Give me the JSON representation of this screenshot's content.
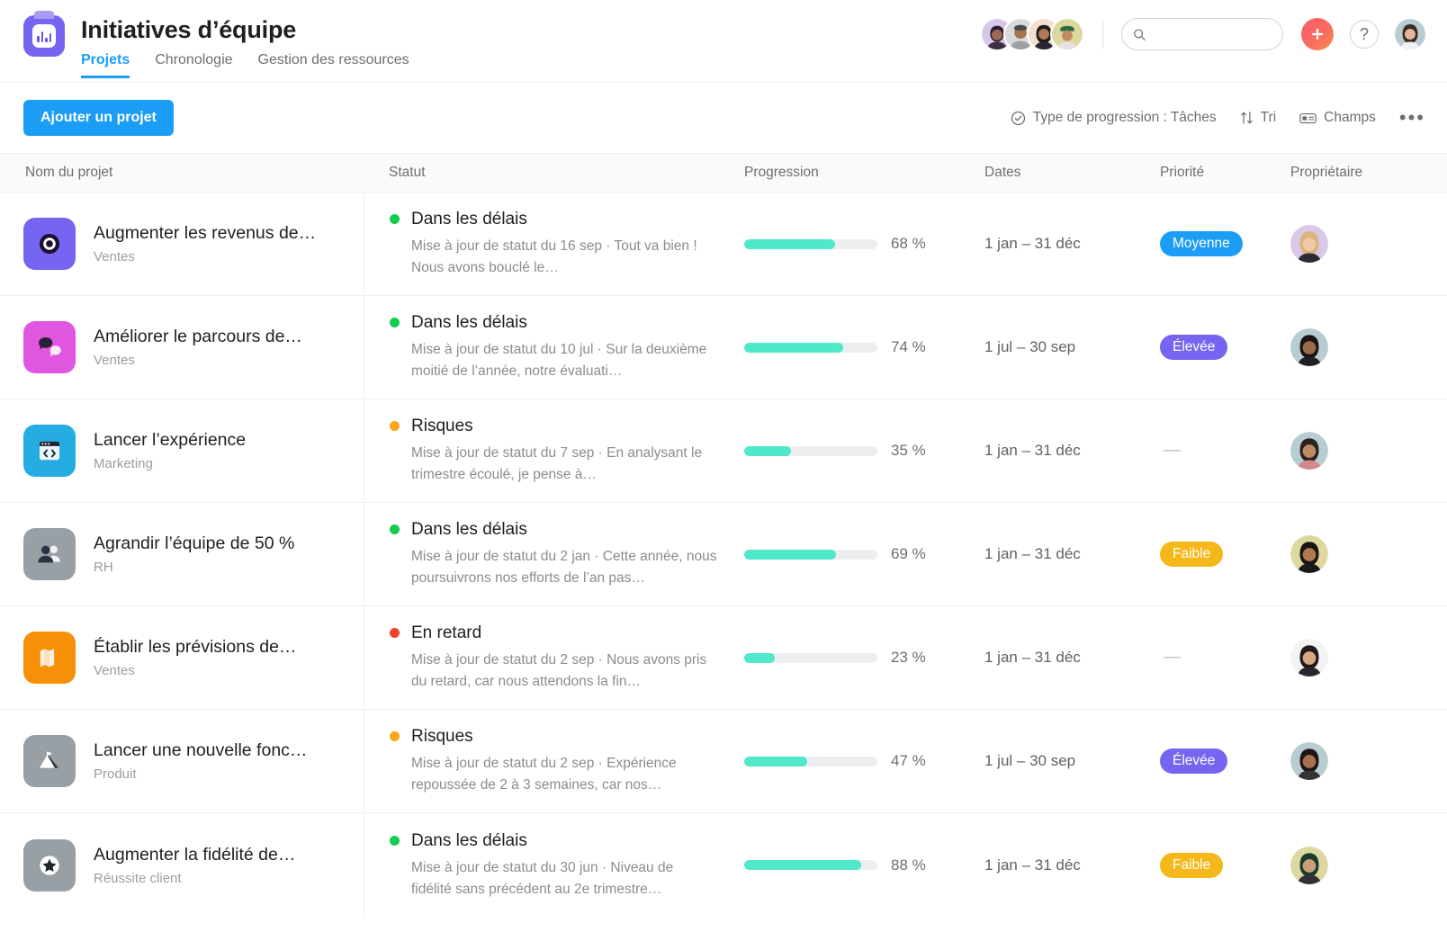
{
  "header": {
    "logo_icon": "chart-app-logo-icon",
    "title": "Initiatives d’équipe",
    "tabs": [
      {
        "label": "Projets",
        "active": true
      },
      {
        "label": "Chronologie",
        "active": false
      },
      {
        "label": "Gestion des ressources",
        "active": false
      }
    ],
    "search": {
      "placeholder": "",
      "value": "",
      "icon": "search-icon"
    },
    "plus_button_icon": "plus-icon",
    "help_button_label": "?",
    "member_avatar_count": 4
  },
  "toolbar": {
    "add_project_label": "Ajouter un projet",
    "progress_type": "Type de progression : Tâches",
    "progress_type_icon": "check-circle-icon",
    "sort_label": "Tri",
    "sort_icon": "sort-arrows-icon",
    "fields_label": "Champs",
    "fields_icon": "fields-icon",
    "more_label": "•••"
  },
  "table": {
    "columns": [
      "Nom du projet",
      "Statut",
      "Progression",
      "Dates",
      "Priorité",
      "Propriétaire"
    ],
    "rows": [
      {
        "name": "Augmenter les revenus de…",
        "team": "Ventes",
        "icon": "target-icon",
        "icon_bg": "#7565f0",
        "status": "Dans les délais",
        "status_color": "#14cc50",
        "note": "Mise à jour de statut du 16 sep · Tout va bien ! Nous avons bouclé le…",
        "progress": 68,
        "progress_label": "68 %",
        "dates": "1 jan – 31 déc",
        "priority": "Moyenne",
        "priority_color": "#1b9df5"
      },
      {
        "name": "Améliorer le parcours de…",
        "team": "Ventes",
        "icon": "speech-bubbles-icon",
        "icon_bg": "#e156e1",
        "status": "Dans les délais",
        "status_color": "#14cc50",
        "note": "Mise à jour de statut du 10 jul · Sur la deuxième moitié de l’année, notre évaluati…",
        "progress": 74,
        "progress_label": "74 %",
        "dates": "1 jul – 30 sep",
        "priority": "Élevée",
        "priority_color": "#7565f0"
      },
      {
        "name": "Lancer l’expérience",
        "team": "Marketing",
        "icon": "code-window-icon",
        "icon_bg": "#25ace3",
        "status": "Risques",
        "status_color": "#f9a61a",
        "note": "Mise à jour de statut du 7 sep ·  En analysant le trimestre écoulé, je pense à…",
        "progress": 35,
        "progress_label": "35 %",
        "dates": "1 jan – 31 déc",
        "priority": "—",
        "priority_color": ""
      },
      {
        "name": "Agrandir l’équipe de 50 %",
        "team": "RH",
        "icon": "people-icon",
        "icon_bg": "#98a0a6",
        "status": "Dans les délais",
        "status_color": "#14cc50",
        "note": "Mise à jour de statut du 2 jan · Cette année, nous poursuivrons nos efforts de l’an pas…",
        "progress": 69,
        "progress_label": "69 %",
        "dates": "1 jan – 31 déc",
        "priority": "Faible",
        "priority_color": "#f5b81a"
      },
      {
        "name": "Établir les prévisions de…",
        "team": "Ventes",
        "icon": "map-icon",
        "icon_bg": "#f79009",
        "status": "En retard",
        "status_color": "#f0402e",
        "note": "Mise à jour de statut du 2 sep · Nous avons pris du retard, car nous attendons la fin…",
        "progress": 23,
        "progress_label": "23 %",
        "dates": "1 jan – 31 déc",
        "priority": "—",
        "priority_color": ""
      },
      {
        "name": "Lancer une nouvelle fonc…",
        "team": "Produit",
        "icon": "mountain-flag-icon",
        "icon_bg": "#98a0a6",
        "status": "Risques",
        "status_color": "#f9a61a",
        "note": "Mise à jour de statut du 2 sep · Expérience repoussée de 2 à 3 semaines, car nos…",
        "progress": 47,
        "progress_label": "47 %",
        "dates": "1 jul – 30 sep",
        "priority": "Élevée",
        "priority_color": "#7565f0"
      },
      {
        "name": "Augmenter la fidélité de…",
        "team": "Réussite client",
        "icon": "star-icon",
        "icon_bg": "#98a0a6",
        "status": "Dans les délais",
        "status_color": "#14cc50",
        "note": "Mise à jour de statut du 30 jun · Niveau de fidélité sans précédent au 2e trimestre…",
        "progress": 88,
        "progress_label": "88 %",
        "dates": "1 jan – 31 déc",
        "priority": "Faible",
        "priority_color": "#f5b81a"
      }
    ]
  },
  "colors": {
    "accent_blue": "#1b9df5",
    "progress_bar": "#4fe8c9",
    "track": "#eceef0",
    "text_dark": "#1e1f21",
    "text_muted": "#8a8c8f"
  }
}
